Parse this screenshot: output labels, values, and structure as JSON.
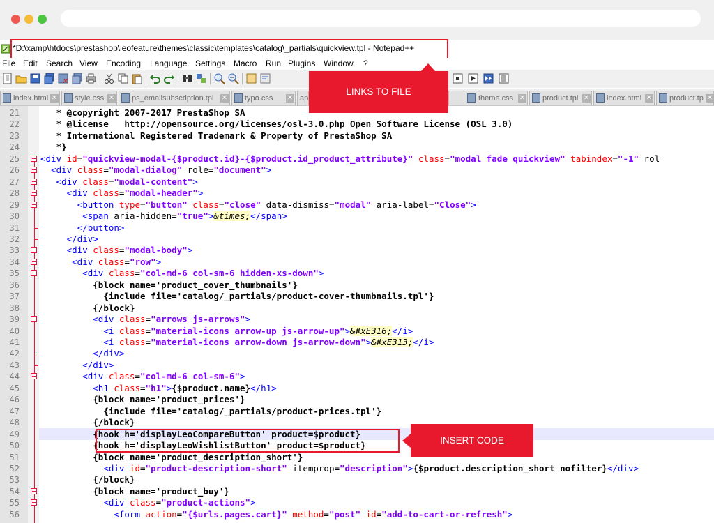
{
  "window": {
    "title": "*D:\\xamp\\htdocs\\prestashop\\leofeature\\themes\\classic\\templates\\catalog\\_partials\\quickview.tpl - Notepad++"
  },
  "menu": [
    "File",
    "Edit",
    "Search",
    "View",
    "Encoding",
    "Language",
    "Settings",
    "Macro",
    "Run",
    "Plugins",
    "Window",
    "?"
  ],
  "tabs": [
    "index.html",
    "style.css",
    "ps_emailsubscription.tpl",
    "typo.css",
    "ap",
    "theme.css",
    "product.tpl",
    "index.html",
    "product.tpl"
  ],
  "callouts": {
    "links_to_file": "LINKS TO FILE",
    "insert_code": "INSERT CODE"
  },
  "colors": {
    "callout": "#e8192c",
    "tag": "#0000ff",
    "attribute": "#ff0000",
    "value": "#8000ff",
    "fold_line": "#e5173c"
  },
  "line_numbers": [
    "21",
    "22",
    "23",
    "24",
    "25",
    "26",
    "27",
    "28",
    "29",
    "30",
    "31",
    "32",
    "33",
    "34",
    "35",
    "36",
    "37",
    "38",
    "39",
    "40",
    "41",
    "42",
    "43",
    "44",
    "45",
    "46",
    "47",
    "48",
    "49",
    "50",
    "51",
    "52",
    "53",
    "54",
    "55",
    "56"
  ],
  "code": [
    [
      [
        "cm",
        "   * @copyright 2007-2017 PrestaShop SA"
      ]
    ],
    [
      [
        "cm",
        "   * @license   http://opensource.org/licenses/osl-3.0.php Open Software License (OSL 3.0)"
      ]
    ],
    [
      [
        "cm",
        "   * International Registered Trademark & Property of PrestaShop SA"
      ]
    ],
    [
      [
        "cm",
        "   *}"
      ]
    ],
    [
      [
        "tag",
        "<div "
      ],
      [
        "attr",
        "id"
      ],
      [
        "plain",
        "="
      ],
      [
        "val",
        "\"quickview-modal-{$product.id}-{$product.id_product_attribute}\""
      ],
      [
        "plain",
        " "
      ],
      [
        "attr",
        "class"
      ],
      [
        "plain",
        "="
      ],
      [
        "val",
        "\"modal fade quickview\""
      ],
      [
        "plain",
        " "
      ],
      [
        "attr",
        "tabindex"
      ],
      [
        "plain",
        "="
      ],
      [
        "val",
        "\"-1\""
      ],
      [
        "plain",
        " rol"
      ]
    ],
    [
      [
        "plain",
        "  "
      ],
      [
        "tag",
        "<div "
      ],
      [
        "attr",
        "class"
      ],
      [
        "plain",
        "="
      ],
      [
        "val",
        "\"modal-dialog\""
      ],
      [
        "plain",
        " "
      ],
      [
        "plain",
        "role"
      ],
      [
        "plain",
        "="
      ],
      [
        "val",
        "\"document\""
      ],
      [
        "tag",
        ">"
      ]
    ],
    [
      [
        "plain",
        "   "
      ],
      [
        "tag",
        "<div "
      ],
      [
        "attr",
        "class"
      ],
      [
        "plain",
        "="
      ],
      [
        "val",
        "\"modal-content\""
      ],
      [
        "tag",
        ">"
      ]
    ],
    [
      [
        "plain",
        "     "
      ],
      [
        "tag",
        "<div "
      ],
      [
        "attr",
        "class"
      ],
      [
        "plain",
        "="
      ],
      [
        "val",
        "\"modal-header\""
      ],
      [
        "tag",
        ">"
      ]
    ],
    [
      [
        "plain",
        "       "
      ],
      [
        "tag",
        "<button "
      ],
      [
        "attr",
        "type"
      ],
      [
        "plain",
        "="
      ],
      [
        "val",
        "\"button\""
      ],
      [
        "plain",
        " "
      ],
      [
        "attr",
        "class"
      ],
      [
        "plain",
        "="
      ],
      [
        "val",
        "\"close\""
      ],
      [
        "plain",
        " data-dismiss="
      ],
      [
        "val",
        "\"modal\""
      ],
      [
        "plain",
        " aria-label="
      ],
      [
        "val",
        "\"Close\""
      ],
      [
        "tag",
        ">"
      ]
    ],
    [
      [
        "plain",
        "        "
      ],
      [
        "tag",
        "<span "
      ],
      [
        "plain",
        "aria-hidden="
      ],
      [
        "val",
        "\"true\""
      ],
      [
        "tag",
        ">"
      ],
      [
        "ent",
        "&times;"
      ],
      [
        "tag",
        "</span>"
      ]
    ],
    [
      [
        "plain",
        "       "
      ],
      [
        "tag",
        "</button>"
      ]
    ],
    [
      [
        "plain",
        "     "
      ],
      [
        "tag",
        "</div>"
      ]
    ],
    [
      [
        "plain",
        "     "
      ],
      [
        "tag",
        "<div "
      ],
      [
        "attr",
        "class"
      ],
      [
        "plain",
        "="
      ],
      [
        "val",
        "\"modal-body\""
      ],
      [
        "tag",
        ">"
      ]
    ],
    [
      [
        "plain",
        "      "
      ],
      [
        "tag",
        "<div "
      ],
      [
        "attr",
        "class"
      ],
      [
        "plain",
        "="
      ],
      [
        "val",
        "\"row\""
      ],
      [
        "tag",
        ">"
      ]
    ],
    [
      [
        "plain",
        "        "
      ],
      [
        "tag",
        "<div "
      ],
      [
        "attr",
        "class"
      ],
      [
        "plain",
        "="
      ],
      [
        "val",
        "\"col-md-6 col-sm-6 hidden-xs-down\""
      ],
      [
        "tag",
        ">"
      ]
    ],
    [
      [
        "plain",
        "          "
      ],
      [
        "sm",
        "{block name='product_cover_thumbnails'}"
      ]
    ],
    [
      [
        "plain",
        "            "
      ],
      [
        "sm",
        "{include file='catalog/_partials/product-cover-thumbnails.tpl'}"
      ]
    ],
    [
      [
        "plain",
        "          "
      ],
      [
        "sm",
        "{/block}"
      ]
    ],
    [
      [
        "plain",
        "          "
      ],
      [
        "tag",
        "<div "
      ],
      [
        "attr",
        "class"
      ],
      [
        "plain",
        "="
      ],
      [
        "val",
        "\"arrows js-arrows\""
      ],
      [
        "tag",
        ">"
      ]
    ],
    [
      [
        "plain",
        "            "
      ],
      [
        "tag",
        "<i "
      ],
      [
        "attr",
        "class"
      ],
      [
        "plain",
        "="
      ],
      [
        "val",
        "\"material-icons arrow-up js-arrow-up\""
      ],
      [
        "tag",
        ">"
      ],
      [
        "ent",
        "&#xE316;"
      ],
      [
        "tag",
        "</i>"
      ]
    ],
    [
      [
        "plain",
        "            "
      ],
      [
        "tag",
        "<i "
      ],
      [
        "attr",
        "class"
      ],
      [
        "plain",
        "="
      ],
      [
        "val",
        "\"material-icons arrow-down js-arrow-down\""
      ],
      [
        "tag",
        ">"
      ],
      [
        "ent",
        "&#xE313;"
      ],
      [
        "tag",
        "</i>"
      ]
    ],
    [
      [
        "plain",
        "          "
      ],
      [
        "tag",
        "</div>"
      ]
    ],
    [
      [
        "plain",
        "        "
      ],
      [
        "tag",
        "</div>"
      ]
    ],
    [
      [
        "plain",
        "        "
      ],
      [
        "tag",
        "<div "
      ],
      [
        "attr",
        "class"
      ],
      [
        "plain",
        "="
      ],
      [
        "val",
        "\"col-md-6 col-sm-6\""
      ],
      [
        "tag",
        ">"
      ]
    ],
    [
      [
        "plain",
        "          "
      ],
      [
        "tag",
        "<h1 "
      ],
      [
        "attr",
        "class"
      ],
      [
        "plain",
        "="
      ],
      [
        "val",
        "\"h1\""
      ],
      [
        "tag",
        ">"
      ],
      [
        "sm",
        "{$product.name}"
      ],
      [
        "tag",
        "</h1>"
      ]
    ],
    [
      [
        "plain",
        "          "
      ],
      [
        "sm",
        "{block name='product_prices'}"
      ]
    ],
    [
      [
        "plain",
        "            "
      ],
      [
        "sm",
        "{include file='catalog/_partials/product-prices.tpl'}"
      ]
    ],
    [
      [
        "plain",
        "          "
      ],
      [
        "sm",
        "{/block}"
      ]
    ],
    [
      [
        "plain",
        "          "
      ],
      [
        "sm",
        "{hook h='displayLeoCompareButton' product=$product}"
      ]
    ],
    [
      [
        "plain",
        "          "
      ],
      [
        "sm",
        "{hook h='displayLeoWishlistButton' product=$product}"
      ]
    ],
    [
      [
        "plain",
        "          "
      ],
      [
        "sm",
        "{block name='product_description_short'}"
      ]
    ],
    [
      [
        "plain",
        "            "
      ],
      [
        "tag",
        "<div "
      ],
      [
        "attr",
        "id"
      ],
      [
        "plain",
        "="
      ],
      [
        "val",
        "\"product-description-short\""
      ],
      [
        "plain",
        " itemprop="
      ],
      [
        "val",
        "\"description\""
      ],
      [
        "tag",
        ">"
      ],
      [
        "sm",
        "{$product.description_short nofilter}"
      ],
      [
        "tag",
        "</div>"
      ]
    ],
    [
      [
        "plain",
        "          "
      ],
      [
        "sm",
        "{/block}"
      ]
    ],
    [
      [
        "plain",
        "          "
      ],
      [
        "sm",
        "{block name='product_buy'}"
      ]
    ],
    [
      [
        "plain",
        "            "
      ],
      [
        "tag",
        "<div "
      ],
      [
        "attr",
        "class"
      ],
      [
        "plain",
        "="
      ],
      [
        "val",
        "\"product-actions\""
      ],
      [
        "tag",
        ">"
      ]
    ],
    [
      [
        "plain",
        "              "
      ],
      [
        "tag",
        "<form "
      ],
      [
        "attr",
        "action"
      ],
      [
        "plain",
        "="
      ],
      [
        "val",
        "\"{$urls.pages.cart}\""
      ],
      [
        "plain",
        " "
      ],
      [
        "attr",
        "method"
      ],
      [
        "plain",
        "="
      ],
      [
        "val",
        "\"post\""
      ],
      [
        "plain",
        " "
      ],
      [
        "attr",
        "id"
      ],
      [
        "plain",
        "="
      ],
      [
        "val",
        "\"add-to-cart-or-refresh\""
      ],
      [
        "tag",
        ">"
      ]
    ]
  ]
}
